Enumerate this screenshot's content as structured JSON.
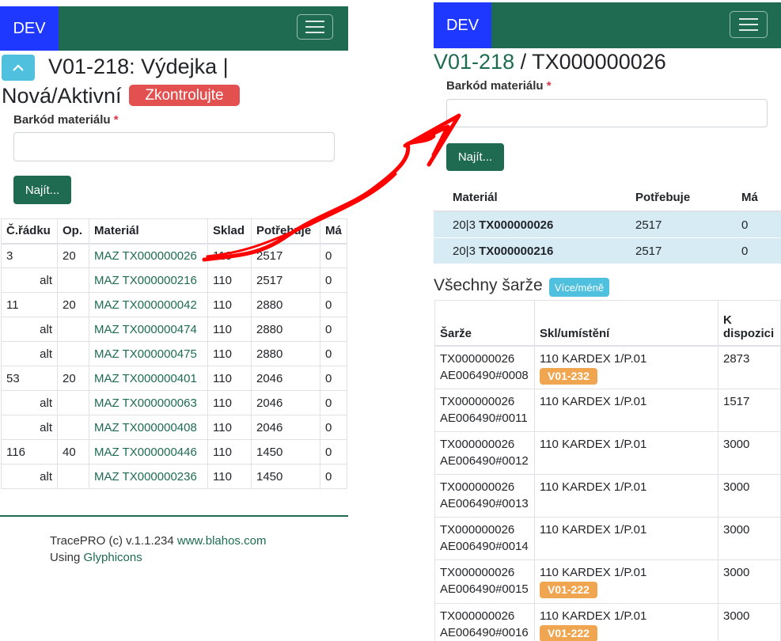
{
  "brand": "DEV",
  "left": {
    "title_line1": "V01-218: Výdejka |",
    "title_line2": "Nová/Aktivní",
    "status_badge": "Zkontrolujte",
    "barcode_label": "Barkód materiálu",
    "required_mark": "*",
    "barcode_value": "",
    "find_button": "Najít...",
    "table": {
      "headers": [
        "Č.řádku",
        "Op.",
        "Materiál",
        "Sklad",
        "Potřebuje",
        "Má"
      ],
      "rows": [
        {
          "line": "3",
          "op": "20",
          "material": "MAZ TX000000026",
          "sklad": "110",
          "potrebuje": "2517",
          "ma": "0"
        },
        {
          "line": "alt",
          "op": "",
          "material": "MAZ TX000000216",
          "sklad": "110",
          "potrebuje": "2517",
          "ma": "0"
        },
        {
          "line": "11",
          "op": "20",
          "material": "MAZ TX000000042",
          "sklad": "110",
          "potrebuje": "2880",
          "ma": "0"
        },
        {
          "line": "alt",
          "op": "",
          "material": "MAZ TX000000474",
          "sklad": "110",
          "potrebuje": "2880",
          "ma": "0"
        },
        {
          "line": "alt",
          "op": "",
          "material": "MAZ TX000000475",
          "sklad": "110",
          "potrebuje": "2880",
          "ma": "0"
        },
        {
          "line": "53",
          "op": "20",
          "material": "MAZ TX000000401",
          "sklad": "110",
          "potrebuje": "2046",
          "ma": "0"
        },
        {
          "line": "alt",
          "op": "",
          "material": "MAZ TX000000063",
          "sklad": "110",
          "potrebuje": "2046",
          "ma": "0"
        },
        {
          "line": "alt",
          "op": "",
          "material": "MAZ TX000000408",
          "sklad": "110",
          "potrebuje": "2046",
          "ma": "0"
        },
        {
          "line": "116",
          "op": "40",
          "material": "MAZ TX000000446",
          "sklad": "110",
          "potrebuje": "1450",
          "ma": "0"
        },
        {
          "line": "alt",
          "op": "",
          "material": "MAZ TX000000236",
          "sklad": "110",
          "potrebuje": "1450",
          "ma": "0"
        }
      ]
    },
    "footer": {
      "copyright": "TracePRO (c) v.1.1.234 ",
      "site_link": "www.blahos.com",
      "using": "Using ",
      "glyph_link": "Glyphicons"
    }
  },
  "right": {
    "title_link": "V01-218",
    "title_rest": " / TX000000026",
    "barcode_label": "Barkód materiálu",
    "required_mark": "*",
    "barcode_value": "",
    "find_button": "Najít...",
    "materials": {
      "headers": [
        "Materiál",
        "Potřebuje",
        "Má"
      ],
      "rows": [
        {
          "prefix": "20|3 ",
          "code": "TX000000026",
          "potrebuje": "2517",
          "ma": "0"
        },
        {
          "prefix": "20|3 ",
          "code": "TX000000216",
          "potrebuje": "2517",
          "ma": "0"
        }
      ]
    },
    "batches_title": "Všechny šarže",
    "more_less": "Více/méně",
    "batches": {
      "headers": [
        "Šarže",
        "Skl/umístění",
        "K dispozici"
      ],
      "rows": [
        {
          "sarze1": "TX000000026",
          "sarze2": "AE006490#0008",
          "loc": "110 KARDEX 1/P.01",
          "tag": "V01-232",
          "qty": "2873"
        },
        {
          "sarze1": "TX000000026",
          "sarze2": "AE006490#0011",
          "loc": "110 KARDEX 1/P.01",
          "tag": "",
          "qty": "1517"
        },
        {
          "sarze1": "TX000000026",
          "sarze2": "AE006490#0012",
          "loc": "110 KARDEX 1/P.01",
          "tag": "",
          "qty": "3000"
        },
        {
          "sarze1": "TX000000026",
          "sarze2": "AE006490#0013",
          "loc": "110 KARDEX 1/P.01",
          "tag": "",
          "qty": "3000"
        },
        {
          "sarze1": "TX000000026",
          "sarze2": "AE006490#0014",
          "loc": "110 KARDEX 1/P.01",
          "tag": "",
          "qty": "3000"
        },
        {
          "sarze1": "TX000000026",
          "sarze2": "AE006490#0015",
          "loc": "110 KARDEX 1/P.01",
          "tag": "V01-222",
          "qty": "3000"
        },
        {
          "sarze1": "TX000000026",
          "sarze2": "AE006490#0016",
          "loc": "110 KARDEX 1/P.01",
          "tag": "V01-222",
          "qty": "3000"
        }
      ]
    }
  },
  "colors": {
    "brand_bg": "#1f38ff",
    "navbar_bg": "#1e6b52",
    "primary": "#1e6b52",
    "danger_badge": "#e35050",
    "info_badge": "#4fc0de",
    "warning_badge": "#f0a650",
    "highlight_row": "#d6ebf3",
    "arrow": "#ff0000"
  }
}
